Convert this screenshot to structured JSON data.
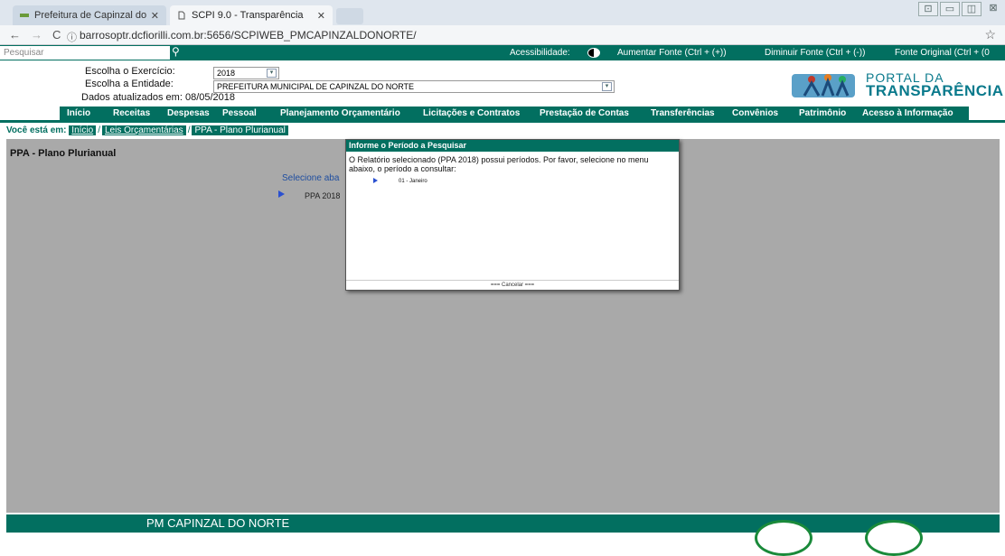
{
  "browser": {
    "tab1_title": "Prefeitura de Capinzal do",
    "tab2_title": "SCPI 9.0 - Transparência",
    "url": "barrosoptr.dcfiorilli.com.br:5656/SCPIWEB_PMCAPINZALDONORTE/"
  },
  "topbar": {
    "search_placeholder": "Pesquisar",
    "accessibility_label": "Acessibilidade:",
    "font_increase": "Aumentar Fonte (Ctrl + (+))",
    "font_decrease": "Diminuir Fonte (Ctrl + (-))",
    "font_original": "Fonte Original (Ctrl + (0"
  },
  "header": {
    "exercise_label": "Escolha o Exercício:",
    "exercise_value": "2018",
    "entity_label": "Escolha a Entidade:",
    "entity_value": "PREFEITURA MUNICIPAL DE CAPINZAL DO NORTE",
    "updated_text": "Dados atualizados em: 08/05/2018",
    "logo_line1": "PORTAL DA",
    "logo_line2": "TRANSPARÊNCIA"
  },
  "menu": {
    "items": [
      "Início",
      "Receitas",
      "Despesas",
      "Pessoal",
      "Planejamento Orçamentário",
      "Licitações e Contratos",
      "Prestação de Contas",
      "Transferências",
      "Convênios",
      "Patrimônio",
      "Acesso à Informação"
    ]
  },
  "breadcrumb": {
    "prefix": "Você está em:",
    "items": [
      "Início",
      "Leis Orçamentárias",
      "PPA - Plano Plurianual"
    ]
  },
  "main": {
    "title": "PPA - Plano Plurianual",
    "select_text": "Selecione aba",
    "ppa_item": "PPA 2018"
  },
  "modal": {
    "title": "Informe o Período a Pesquisar",
    "message": "O Relatório selecionado (PPA 2018) possui períodos. Por favor, selecione no menu abaixo, o período a consultar:",
    "period": "01 - Janeiro",
    "cancel": "=== Cancelar ==="
  },
  "footer": {
    "text": "PM CAPINZAL DO NORTE"
  },
  "colors": {
    "brand_green": "#026f60",
    "content_gray": "#a9a9a9"
  }
}
